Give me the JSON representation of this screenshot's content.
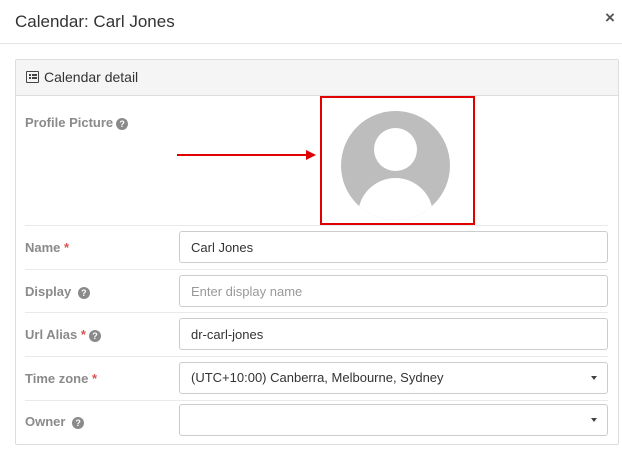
{
  "modal": {
    "title": "Calendar: Carl Jones",
    "close_glyph": "×"
  },
  "panel": {
    "title": "Calendar detail",
    "icon": "list-alt-icon"
  },
  "fields": {
    "profile_picture": {
      "label": "Profile Picture",
      "help_glyph": "?"
    },
    "name": {
      "label": "Name",
      "required_mark": "*",
      "value": "Carl Jones"
    },
    "display": {
      "label": "Display",
      "help_glyph": "?",
      "value": "",
      "placeholder": "Enter display name"
    },
    "url_alias": {
      "label": "Url Alias",
      "required_mark": "*",
      "help_glyph": "?",
      "value": "dr-carl-jones"
    },
    "time_zone": {
      "label": "Time zone",
      "required_mark": "*",
      "value": "(UTC+10:00) Canberra, Melbourne, Sydney"
    },
    "owner": {
      "label": "Owner",
      "help_glyph": "?",
      "value": ""
    }
  },
  "colors": {
    "annotation": "#e00000",
    "required": "#d9534f",
    "label": "#8a8a8a",
    "avatar_bg": "#bdbdbd"
  }
}
